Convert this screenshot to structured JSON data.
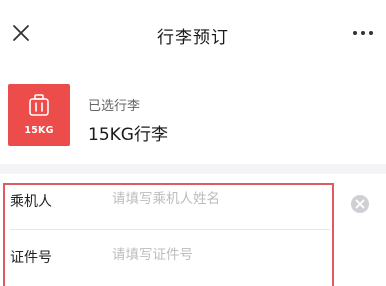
{
  "navbar": {
    "title": "行李预订",
    "close_icon": "close-icon",
    "more_icon": "more-icon"
  },
  "baggage": {
    "badge_text": "15KG",
    "badge_icon": "suitcase-icon",
    "badge_color": "#ec4d4a",
    "subtitle": "已选行李",
    "title": "15KG行李"
  },
  "form": {
    "passenger": {
      "label": "乘机人",
      "placeholder": "请填写乘机人姓名",
      "clear_icon": "clear-icon"
    },
    "id_number": {
      "label": "证件号",
      "placeholder": "请填写证件号"
    },
    "highlight_color": "#e05a62"
  }
}
